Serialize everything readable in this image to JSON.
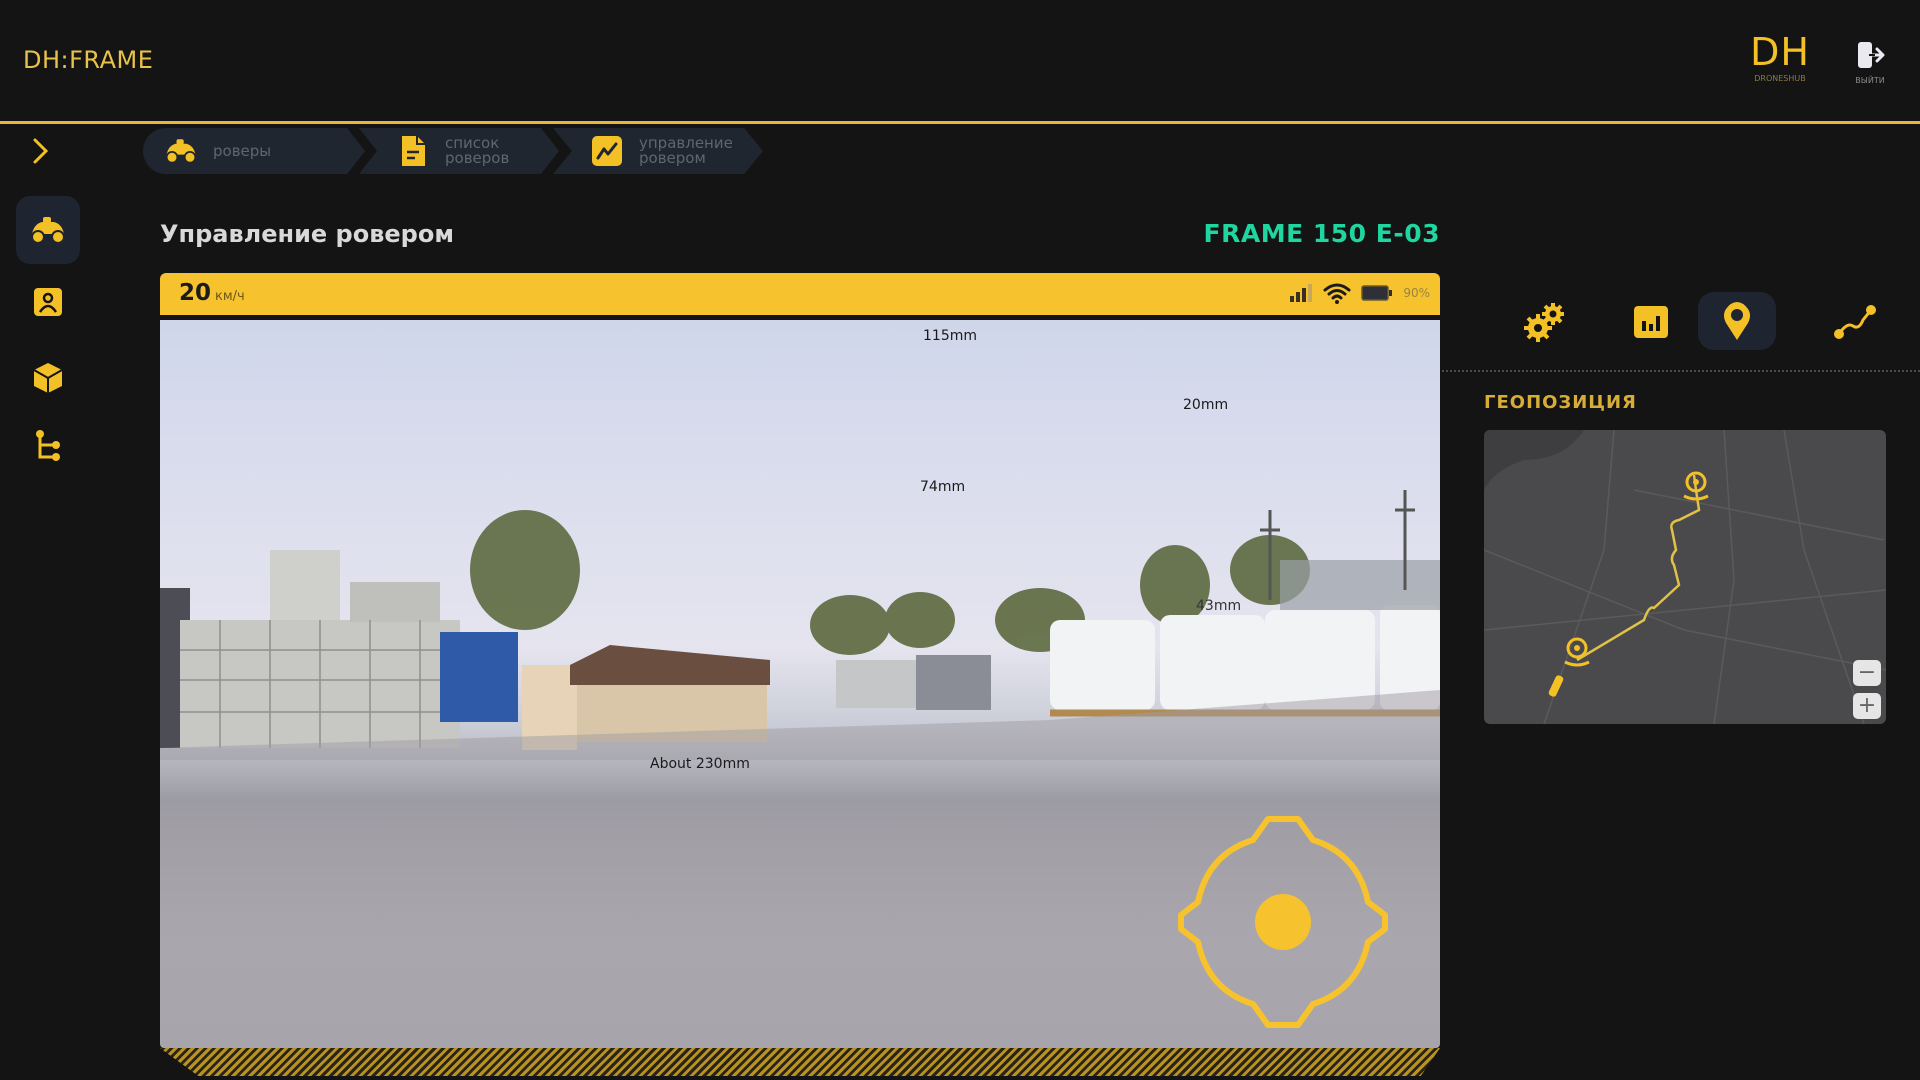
{
  "header": {
    "app_title": "DH:FRAME",
    "brand_mark": "DH",
    "brand_sub": "DRONESHUB",
    "exit_label": "ВЫЙТИ"
  },
  "breadcrumb": [
    {
      "label": "роверы",
      "icon": "car-icon"
    },
    {
      "label": "список роверов",
      "icon": "document-icon"
    },
    {
      "label": "управление ровером",
      "icon": "trend-icon"
    }
  ],
  "sidebar": {
    "items": [
      {
        "name": "rovers",
        "icon": "car-icon",
        "active": true
      },
      {
        "name": "users",
        "icon": "user-badge-icon",
        "active": false
      },
      {
        "name": "objects",
        "icon": "cube-icon",
        "active": false
      },
      {
        "name": "structure",
        "icon": "tree-icon",
        "active": false
      }
    ]
  },
  "main": {
    "title": "Управление ровером",
    "rover_name": "FRAME 150 E-03",
    "status": {
      "speed": "20",
      "speed_unit": "км/ч",
      "signal_icon": "signal-bars-icon",
      "wifi_icon": "wifi-icon",
      "battery_icon": "battery-icon",
      "battery_percent": "90%"
    },
    "video_annotations": [
      {
        "text": "115mm"
      },
      {
        "text": "20mm"
      },
      {
        "text": "74mm"
      },
      {
        "text": "43mm"
      },
      {
        "text": "About 230mm"
      }
    ],
    "joystick": {
      "icon": "joystick-icon"
    }
  },
  "right_panel": {
    "tabs": [
      {
        "name": "settings",
        "icon": "gears-icon",
        "active": false
      },
      {
        "name": "stats",
        "icon": "bar-chart-icon",
        "active": false
      },
      {
        "name": "location",
        "icon": "map-pin-icon",
        "active": true
      },
      {
        "name": "route",
        "icon": "route-icon",
        "active": false
      }
    ],
    "section_title": "ГЕОПОЗИЦИЯ",
    "map": {
      "zoom_out": "−",
      "zoom_in": "+"
    }
  },
  "colors": {
    "accent": "#f6c22e",
    "rover_name": "#1fd6a0",
    "background": "#141414"
  }
}
